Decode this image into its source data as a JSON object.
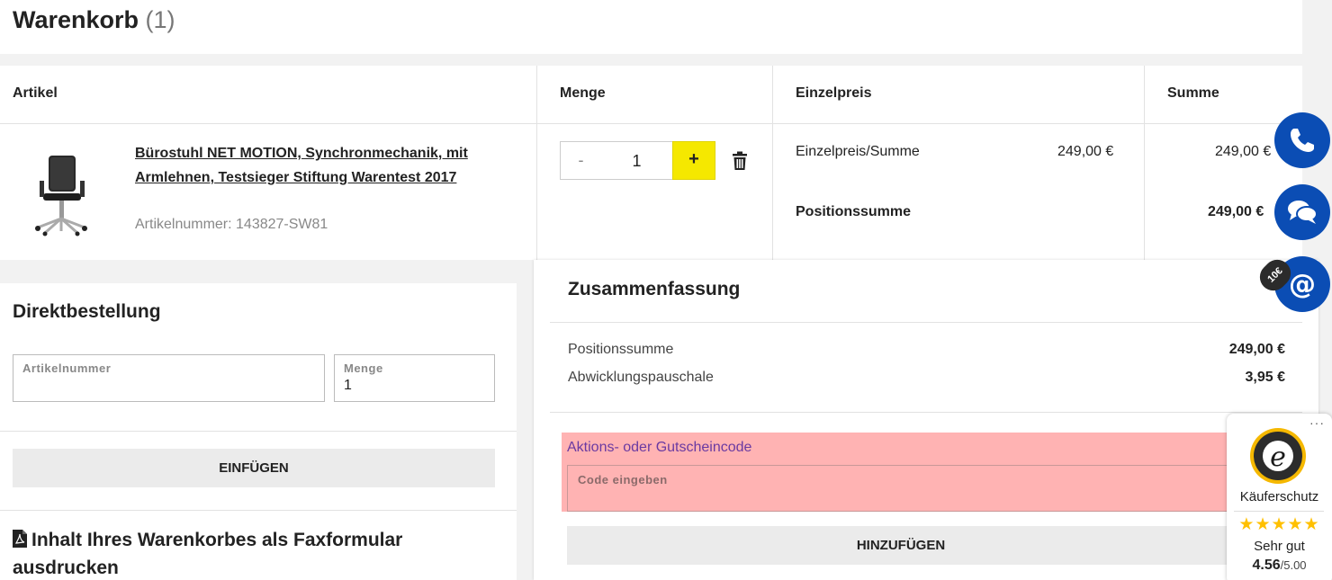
{
  "header": {
    "title": "Warenkorb",
    "count": "(1)"
  },
  "table": {
    "headers": {
      "artikel": "Artikel",
      "menge": "Menge",
      "einzelpreis": "Einzelpreis",
      "summe": "Summe"
    },
    "item": {
      "name": "Bürostuhl NET MOTION, Synchronmechanik, mit Armlehnen, Testsieger Stiftung Warentest 2017",
      "artnr": "Artikelnummer: 143827-SW81",
      "qty_minus": "-",
      "qty": "1",
      "qty_plus": "+",
      "unit_label": "Einzelpreis/Summe",
      "unit_price": "249,00 €",
      "sum_price": "249,00 €",
      "pos_label": "Positionssumme",
      "pos_sum": "249,00 €"
    }
  },
  "direkt": {
    "title": "Direktbestellung",
    "artnr_label": "Artikelnummer",
    "artnr_value": "",
    "menge_label": "Menge",
    "menge_value": "1",
    "insert_btn": "EINFÜGEN",
    "fax_text": "Inhalt Ihres Warenkorbes als Faxformular ausdrucken"
  },
  "summary": {
    "title": "Zusammenfassung",
    "rows": [
      {
        "label": "Positionssumme",
        "value": "249,00 €"
      },
      {
        "label": "Abwicklungspauschale",
        "value": "3,95 €"
      }
    ],
    "voucher_label": "Aktions- oder Gutscheincode",
    "voucher_placeholder": "Code eingeben",
    "add_btn": "HINZUFÜGEN"
  },
  "floating": {
    "badge": "10€",
    "icons": [
      "phone-icon",
      "chat-icon",
      "email-icon"
    ],
    "color": "#0b4db4"
  },
  "trusted_shops": {
    "dots": "···",
    "label": "Käuferschutz",
    "stars": "★★★★★",
    "rating": 4.56,
    "grade": "Sehr gut",
    "score": "4.56",
    "max": "/5.00"
  },
  "colors": {
    "accent": "#f5e800",
    "button_grey": "#ebebeb",
    "highlight": "#ffb3b3"
  }
}
